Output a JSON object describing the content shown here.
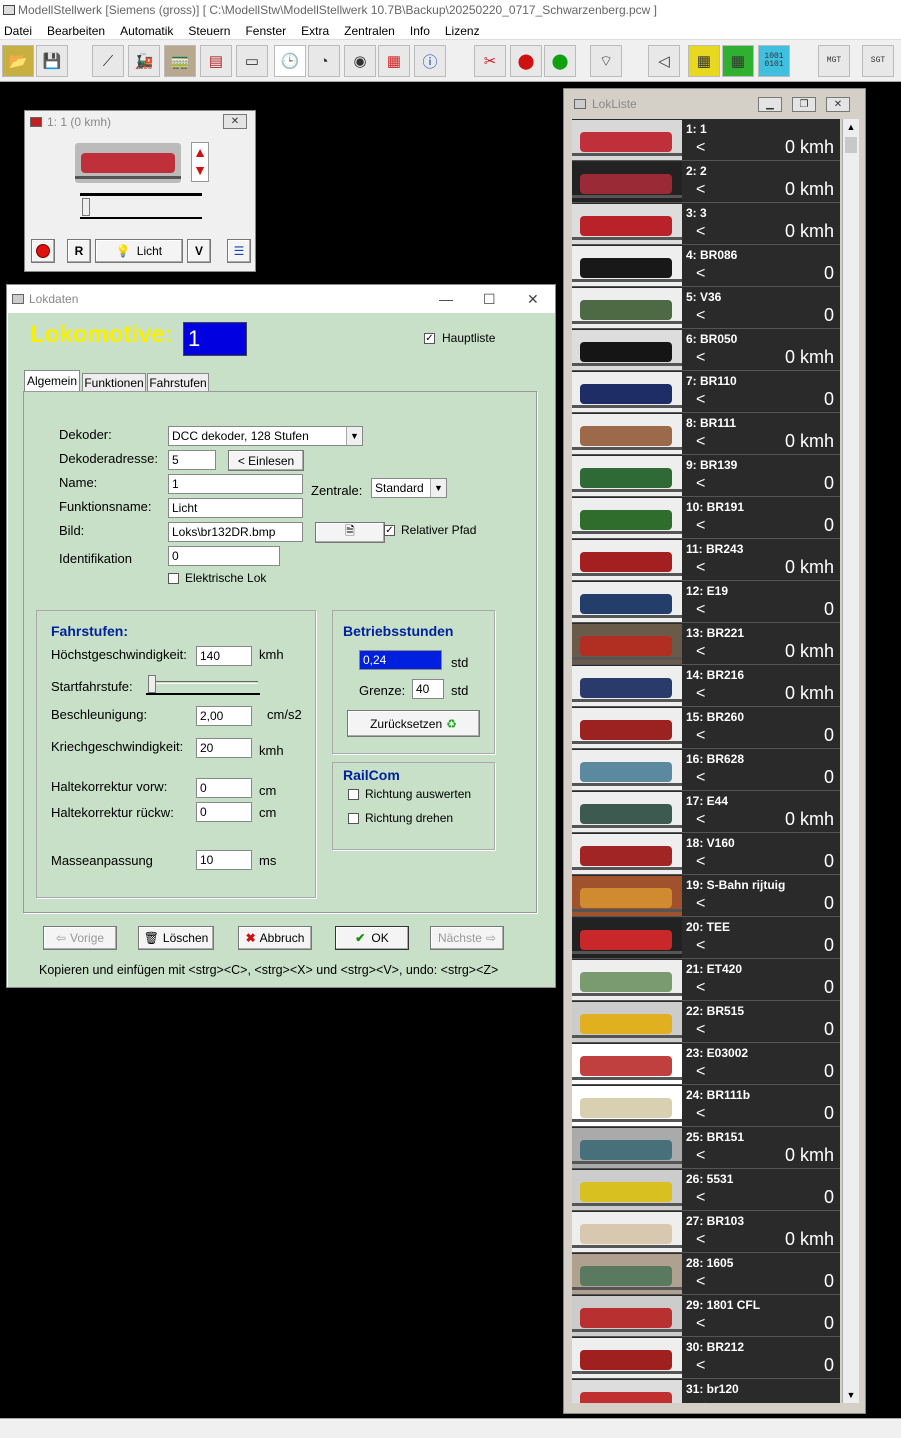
{
  "app": {
    "title": "ModellStellwerk [Siemens (gross)]  [ C:\\ModellStw\\ModellStellwerk 10.7B\\Backup\\20250220_0717_Schwarzenberg.pcw ]",
    "menu": [
      "Datei",
      "Bearbeiten",
      "Automatik",
      "Steuern",
      "Fenster",
      "Extra",
      "Zentralen",
      "Info",
      "Lizenz"
    ],
    "toolbar_icons": [
      "open-folder-icon",
      "save-icon",
      "track-icon",
      "locomotive-icon",
      "train-icon",
      "loco-list-icon",
      "display-icon",
      "clock-icon",
      "gauge-icon",
      "sound-icon",
      "matrix-icon",
      "info-icon",
      "tools-icon",
      "signal-red-icon",
      "signal-green-icon",
      "wifi-icon",
      "speaker-icon",
      "grid-yellow-icon",
      "grid-green-icon",
      "binary-icon",
      "mgt-icon",
      "sgt-icon"
    ],
    "binary_text": "1001\n0101",
    "mgt_text": "MGT",
    "sgt_text": "SGT"
  },
  "throttle": {
    "title": "1: 1 (0 kmh)",
    "btn_r": "R",
    "btn_licht": "Licht",
    "btn_v": "V",
    "speed_fraction": 0.02
  },
  "lokdaten": {
    "title": "Lokdaten",
    "heading": "Lokomotive:",
    "number": "1",
    "hauptliste_label": "Hauptliste",
    "tabs": [
      "Algemein",
      "Funktionen",
      "Fahrstufen"
    ],
    "labels": {
      "dekoder": "Dekoder:",
      "adresse": "Dekoderadresse:",
      "name": "Name:",
      "funktionsname": "Funktionsname:",
      "bild": "Bild:",
      "identifikation": "Identifikation",
      "zentrale": "Zentrale:",
      "relativer": "Relativer Pfad",
      "elektrische": "Elektrische Lok"
    },
    "values": {
      "dekoder": "DCC dekoder, 128 Stufen",
      "adresse": "5",
      "name": "1",
      "funktionsname": "Licht",
      "bild": "Loks\\br132DR.bmp",
      "identifikation": "0",
      "zentrale": "Standard"
    },
    "einlesen": "< Einlesen",
    "fahrstufen": {
      "title": "Fahrstufen:",
      "hoechst": "Höchstgeschwindigkeit:",
      "hoechst_val": "140",
      "hoechst_unit": "kmh",
      "start": "Startfahrstufe:",
      "beschl": "Beschleunigung:",
      "beschl_val": "2,00",
      "beschl_unit": "cm/s2",
      "kriech": "Kriechgeschwindigkeit:",
      "kriech_val": "20",
      "kriech_unit": "kmh",
      "halte_vorw": "Haltekorrektur vorw:",
      "halte_vorw_val": "0",
      "halte_vorw_unit": "cm",
      "halte_rueck": "Haltekorrektur rückw:",
      "halte_rueck_val": "0",
      "halte_rueck_unit": "cm",
      "masse": "Masseanpassung",
      "masse_val": "10",
      "masse_unit": "ms"
    },
    "betrieb": {
      "title": "Betriebsstunden",
      "value": "0,24",
      "unit": "std",
      "grenze": "Grenze:",
      "grenze_val": "40",
      "grenze_unit": "std",
      "reset": "Zurücksetzen"
    },
    "railcom": {
      "title": "RailCom",
      "auswerten": "Richtung auswerten",
      "drehen": "Richtung drehen"
    },
    "buttons": {
      "vorige": "Vorige",
      "loeschen": "Löschen",
      "abbruch": "Abbruch",
      "ok": "OK",
      "naechste": "Nächste"
    },
    "hint": "Kopieren und einfügen mit <strg><C>, <strg><X> und <strg><V>, undo: <strg><Z>"
  },
  "loklist": {
    "title": "LokListe",
    "items": [
      {
        "name": "1: 1",
        "dir": "<",
        "speed": "0 kmh",
        "color": "#c0303a",
        "bg": "#d8d8d8"
      },
      {
        "name": "2: 2",
        "dir": "<",
        "speed": "0 kmh",
        "color": "#9a2a36",
        "bg": "#222"
      },
      {
        "name": "3: 3",
        "dir": "<",
        "speed": "0 kmh",
        "color": "#b82228",
        "bg": "#ddd"
      },
      {
        "name": "4: BR086",
        "dir": "<",
        "speed": "0",
        "color": "#181818",
        "bg": "#eee"
      },
      {
        "name": "5: V36",
        "dir": "<",
        "speed": "0",
        "color": "#4d6a45",
        "bg": "#eee"
      },
      {
        "name": "6: BR050",
        "dir": "<",
        "speed": "0 kmh",
        "color": "#151515",
        "bg": "#ddd"
      },
      {
        "name": "7: BR110",
        "dir": "<",
        "speed": "0",
        "color": "#1f2d66",
        "bg": "#eee"
      },
      {
        "name": "8: BR111",
        "dir": "<",
        "speed": "0 kmh",
        "color": "#9c6a4a",
        "bg": "#eee"
      },
      {
        "name": "9: BR139",
        "dir": "<",
        "speed": "0",
        "color": "#2f6a36",
        "bg": "#eee"
      },
      {
        "name": "10: BR191",
        "dir": "<",
        "speed": "0",
        "color": "#2f6d2c",
        "bg": "#eee"
      },
      {
        "name": "11: BR243",
        "dir": "<",
        "speed": "0 kmh",
        "color": "#a42020",
        "bg": "#eee"
      },
      {
        "name": "12: E19",
        "dir": "<",
        "speed": "0",
        "color": "#243e6b",
        "bg": "#eee"
      },
      {
        "name": "13: BR221",
        "dir": "<",
        "speed": "0 kmh",
        "color": "#b02e22",
        "bg": "#6a5a4a"
      },
      {
        "name": "14: BR216",
        "dir": "<",
        "speed": "0 kmh",
        "color": "#2a3a6a",
        "bg": "#eee"
      },
      {
        "name": "15: BR260",
        "dir": "<",
        "speed": "0",
        "color": "#9c2222",
        "bg": "#eee"
      },
      {
        "name": "16: BR628",
        "dir": "<",
        "speed": "0",
        "color": "#5b8aa0",
        "bg": "#eee"
      },
      {
        "name": "17: E44",
        "dir": "<",
        "speed": "0 kmh",
        "color": "#3d5a50",
        "bg": "#eee"
      },
      {
        "name": "18: V160",
        "dir": "<",
        "speed": "0",
        "color": "#a22525",
        "bg": "#eee"
      },
      {
        "name": "19: S-Bahn rijtuig",
        "dir": "<",
        "speed": "0",
        "color": "#d08a30",
        "bg": "#a0522d"
      },
      {
        "name": "20: TEE",
        "dir": "<",
        "speed": "0",
        "color": "#c8282a",
        "bg": "#222"
      },
      {
        "name": "21: ET420",
        "dir": "<",
        "speed": "0",
        "color": "#7a9a70",
        "bg": "#eee"
      },
      {
        "name": "22: BR515",
        "dir": "<",
        "speed": "0",
        "color": "#e0b020",
        "bg": "#ccc"
      },
      {
        "name": "23: E03002",
        "dir": "<",
        "speed": "0",
        "color": "#c04040",
        "bg": "#fff"
      },
      {
        "name": "24: BR111b",
        "dir": "<",
        "speed": "0",
        "color": "#d8d0b0",
        "bg": "#fff"
      },
      {
        "name": "25: BR151",
        "dir": "<",
        "speed": "0 kmh",
        "color": "#48707a",
        "bg": "#aaa"
      },
      {
        "name": "26: 5531",
        "dir": "<",
        "speed": "0",
        "color": "#d8c020",
        "bg": "#ccc"
      },
      {
        "name": "27: BR103",
        "dir": "<",
        "speed": "0 kmh",
        "color": "#d8c8b0",
        "bg": "#eee"
      },
      {
        "name": "28: 1605",
        "dir": "<",
        "speed": "0",
        "color": "#5a7a60",
        "bg": "#b0a090"
      },
      {
        "name": "29: 1801 CFL",
        "dir": "<",
        "speed": "0",
        "color": "#b83030",
        "bg": "#ccc"
      },
      {
        "name": "30: BR212",
        "dir": "<",
        "speed": "0",
        "color": "#a02020",
        "bg": "#eee"
      },
      {
        "name": "31: br120",
        "dir": "<",
        "speed": "",
        "color": "#c03030",
        "bg": "#ddd"
      }
    ]
  }
}
